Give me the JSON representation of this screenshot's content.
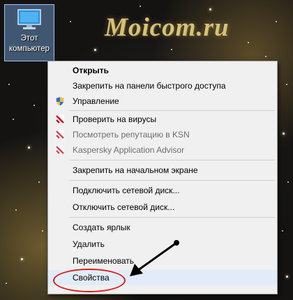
{
  "desktop": {
    "watermark_text": "Moicom.ru",
    "icon": {
      "name": "computer-icon",
      "label_line1": "Этот",
      "label_line2": "компьютер"
    }
  },
  "context_menu": {
    "items": [
      {
        "label": "Открыть",
        "bold": true
      },
      {
        "label": "Закрепить на панели быстрого доступа"
      },
      {
        "label": "Управление",
        "icon": "shield-icon"
      },
      {
        "label": "Проверить на вирусы",
        "icon": "kaspersky-icon"
      },
      {
        "label": "Посмотреть репутацию в KSN",
        "icon": "kaspersky-icon",
        "disabled": true
      },
      {
        "label": "Kaspersky Application Advisor",
        "icon": "kaspersky-icon",
        "disabled": true
      },
      {
        "label": "Закрепить на начальном экране"
      },
      {
        "label": "Подключить сетевой диск..."
      },
      {
        "label": "Отключить сетевой диск..."
      },
      {
        "label": "Создать ярлык"
      },
      {
        "label": "Удалить"
      },
      {
        "label": "Переименовать"
      },
      {
        "label": "Свойства",
        "highlighted": true
      }
    ]
  },
  "annotation": {
    "circle_color": "#d81f1f",
    "arrow_color": "#000000"
  }
}
